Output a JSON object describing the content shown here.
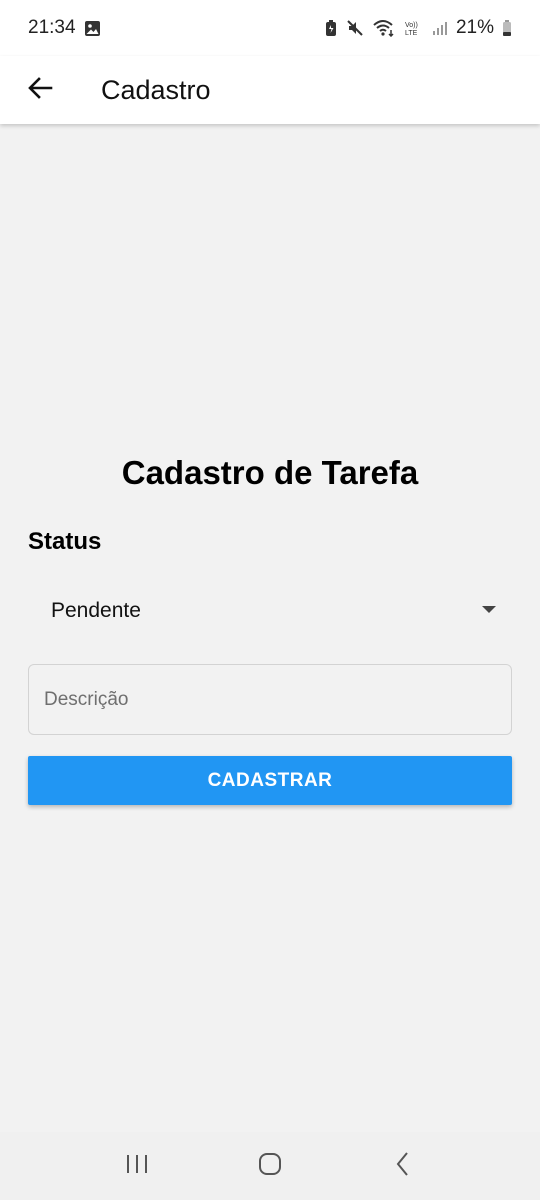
{
  "status_bar": {
    "time": "21:34",
    "battery_percent": "21%",
    "icons": [
      "gallery-icon",
      "battery-saver-icon",
      "mute-icon",
      "wifi-icon",
      "volte-icon",
      "signal-icon",
      "battery-icon"
    ],
    "volte_text": "Vo)) LTE"
  },
  "app_bar": {
    "title": "Cadastro",
    "back_icon": "arrow-back-icon"
  },
  "form": {
    "heading": "Cadastro de Tarefa",
    "status_label": "Status",
    "status_value": "Pendente",
    "description_placeholder": "Descrição",
    "description_value": "",
    "submit_label": "CADASTRAR"
  },
  "nav_bar": {
    "recents_icon": "recents-icon",
    "home_icon": "home-icon",
    "back_icon": "back-icon"
  },
  "colors": {
    "accent": "#2196f3",
    "background": "#f2f2f2",
    "app_bar": "#ffffff"
  }
}
